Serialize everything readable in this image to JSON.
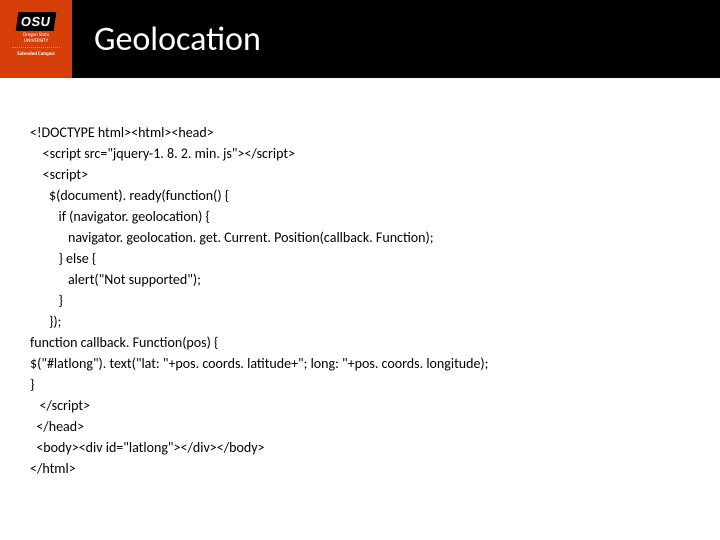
{
  "logo": {
    "main": "OSU",
    "sub1": "Oregon State",
    "sub2": "UNIVERSITY",
    "ext": "Extended Campus"
  },
  "title": "Geolocation",
  "code": {
    "l0": "<!DOCTYPE html><html><head>",
    "l1": "    <script src=\"jquery-1. 8. 2. min. js\"></script>",
    "l2": "    <script>",
    "l3": "      $(document). ready(function() {",
    "l4": "         if (navigator. geolocation) {",
    "l5": "            navigator. geolocation. get. Current. Position(callback. Function);",
    "l6": "         } else {",
    "l7": "            alert(\"Not supported\");",
    "l8": "         }",
    "l9": "      });",
    "l10": "function callback. Function(pos) {",
    "l11": "$(\"#latlong\"). text(\"lat: \"+pos. coords. latitude+\"; long: \"+pos. coords. longitude);",
    "l12": "}",
    "l13": "   </script>",
    "l14": "  </head>",
    "l15": "  <body><div id=\"latlong\"></div></body>",
    "l16": "</html>"
  }
}
